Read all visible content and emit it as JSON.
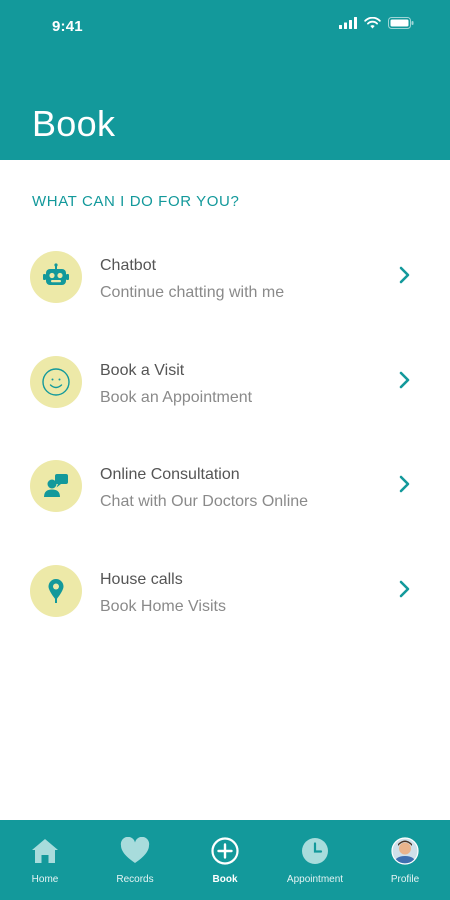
{
  "status_bar": {
    "time": "9:41"
  },
  "header": {
    "title": "Book"
  },
  "section": {
    "heading": "WHAT CAN I DO FOR YOU?"
  },
  "menu": {
    "items": [
      {
        "title": "Chatbot",
        "subtitle": "Continue chatting with me",
        "icon": "robot-icon"
      },
      {
        "title": "Book a Visit",
        "subtitle": "Book an Appointment",
        "icon": "smiley-icon"
      },
      {
        "title": "Online Consultation",
        "subtitle": "Chat with Our Doctors Online",
        "icon": "doctor-chat-icon"
      },
      {
        "title": "House calls",
        "subtitle": "Book Home Visits",
        "icon": "location-pin-icon"
      }
    ]
  },
  "tabbar": {
    "tabs": [
      {
        "label": "Home",
        "icon": "home-icon"
      },
      {
        "label": "Records",
        "icon": "heart-icon"
      },
      {
        "label": "Book",
        "icon": "plus-circle-icon",
        "active": true
      },
      {
        "label": "Appointment",
        "icon": "clock-icon"
      },
      {
        "label": "Profile",
        "icon": "avatar"
      }
    ]
  },
  "colors": {
    "primary": "#13999b",
    "icon_background": "#ede9a8",
    "title_text": "#555555",
    "subtitle_text": "#8a8a8a"
  }
}
